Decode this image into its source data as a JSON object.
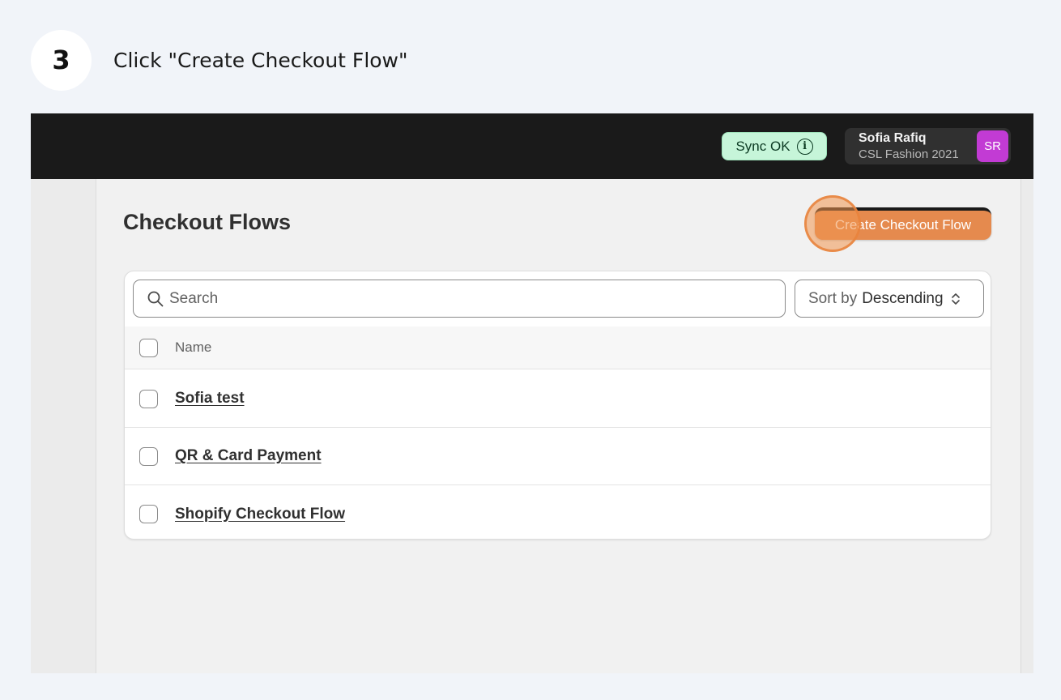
{
  "step": {
    "number": "3",
    "instruction": "Click \"Create Checkout Flow\""
  },
  "topbar": {
    "sync_label": "Sync OK",
    "sync_icon": "info-icon",
    "user": {
      "name": "Sofia Rafiq",
      "org": "CSL Fashion 2021",
      "initials": "SR",
      "avatar_color": "#c23bd4"
    }
  },
  "page": {
    "title": "Checkout Flows",
    "create_button_label": "Create Checkout Flow",
    "accent_color": "#e58a4e"
  },
  "toolbar": {
    "search_placeholder": "Search",
    "sort_prefix": "Sort by",
    "sort_value": "Descending"
  },
  "table": {
    "column_name": "Name",
    "rows": [
      {
        "name": "Sofia test"
      },
      {
        "name": "QR & Card Payment"
      },
      {
        "name": "Shopify Checkout Flow"
      }
    ]
  }
}
